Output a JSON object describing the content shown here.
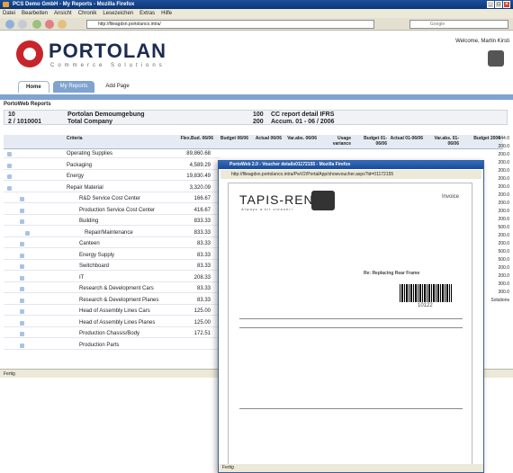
{
  "window": {
    "title": "PCS Demo GmbH - My Reports - Mozilla Firefox"
  },
  "menu": [
    "Datei",
    "Bearbeiten",
    "Ansicht",
    "Chronik",
    "Lesezeichen",
    "Extras",
    "Hilfe"
  ],
  "nav": {
    "url": "http://fileagdxn.portolanco.intra/",
    "search_placeholder": "Google"
  },
  "brand": {
    "name": "PORTOLAN",
    "tagline": "Commerce Solutions"
  },
  "welcome": "Welcome, Martin Kirsti",
  "tabs": [
    "Home",
    "My Reports",
    "Add Page"
  ],
  "report": {
    "section": "PortoWeb Reports",
    "left_ids": [
      "10",
      "2 / 1010001"
    ],
    "left_names": [
      "Portolan Demoumgebung",
      "Total Company"
    ],
    "right_ids": [
      "100",
      "200"
    ],
    "right_names": [
      "CC report detail IFRS",
      "Accum. 01 - 06 / 2006"
    ]
  },
  "columns": [
    "Criteria",
    "Flex.Bud. 06/06",
    "Budget 06/06",
    "Actual 06/06",
    "Var.abs. 06/06",
    "Usage variance",
    "Budget 01-06/06",
    "Actual 01-06/06",
    "Var.abs. 01-06/06",
    "Budget 2006"
  ],
  "rows": [
    {
      "label": "Operating Supplies",
      "value": "89,860.68"
    },
    {
      "label": "Packaging",
      "value": "4,589.29"
    },
    {
      "label": "Energy",
      "value": "19,830.49"
    },
    {
      "label": "Repair Material",
      "value": "3,320.09"
    },
    {
      "label": "R&D Service Cost Center",
      "value": "166.67"
    },
    {
      "label": "Production Service Cost Center",
      "value": "416.67"
    },
    {
      "label": "Building",
      "value": "833.33"
    },
    {
      "label": "Repair/Maintenance",
      "value": "833.33"
    },
    {
      "label": "Canteen",
      "value": "83.33"
    },
    {
      "label": "Energy Supply",
      "value": "83.33"
    },
    {
      "label": "Switchboard",
      "value": "83.33"
    },
    {
      "label": "IT",
      "value": "208.33"
    },
    {
      "label": "Research & Development Cars",
      "value": "83.33"
    },
    {
      "label": "Research & Development Planes",
      "value": "83.33"
    },
    {
      "label": "Head of Assembly Lines Cars",
      "value": "125.00"
    },
    {
      "label": "Head of Assembly Lines Planes",
      "value": "125.00"
    },
    {
      "label": "Production Chassis/Body",
      "value": "172.51"
    },
    {
      "label": "Production Parts",
      "value": ""
    }
  ],
  "right_col": [
    "444.0",
    "200.0",
    "200.0",
    "200.0",
    "200.0",
    "200.0",
    "200.0",
    "200.0",
    "200.0",
    "200.0",
    "200.0",
    "500.0",
    "200.0",
    "200.0",
    "500.0",
    "500.0",
    "200.0",
    "200.0",
    "300.0",
    "300.0",
    "Solutions"
  ],
  "status": "Fertig",
  "popup": {
    "title": "PortoWeb 2.0 - Voucher details01172155 - Mozilla Firefox",
    "url": "http://fileagdxn.portolanco.intra/PwV2/PortalApp/showvoucher.aspx?id=01172155",
    "company": "TAPIS-RENT",
    "tagline": "Always a bit cleaner!",
    "invoice": "Invoice",
    "subject": "Re: Replacing Rear Frame",
    "barcode_no": "10122",
    "status": "Fertig"
  }
}
